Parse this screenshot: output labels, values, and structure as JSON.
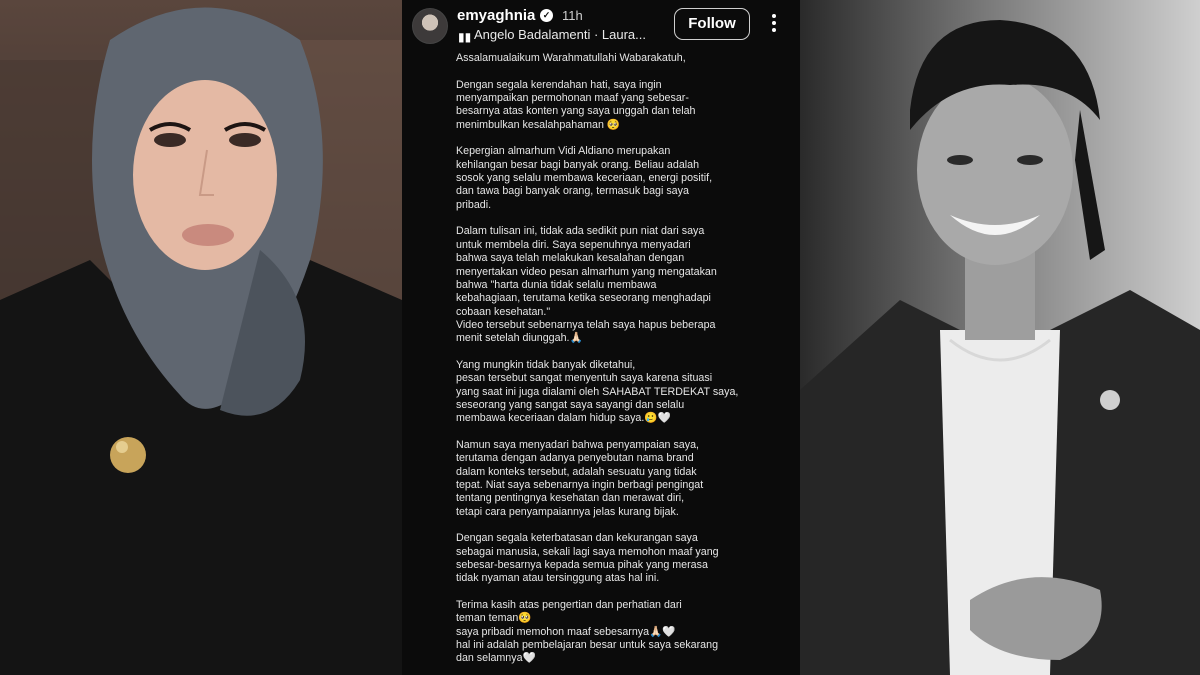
{
  "story": {
    "username": "emyaghnia",
    "time": "11h",
    "music": "Angelo Badalamenti · Laura...",
    "follow_label": "Follow",
    "icons": {
      "verified": "verified-badge-icon",
      "music": "music-note-icon",
      "more": "more-vertical-icon"
    },
    "paragraphs": [
      [
        "Assalamualaikum Warahmatullahi Wabarakatuh,"
      ],
      [
        "Dengan segala kerendahan hati, saya ingin",
        "menyampaikan permohonan maaf yang sebesar-",
        "besarnya atas konten yang saya unggah dan telah",
        "menimbulkan kesalahpahaman 🥺"
      ],
      [
        "Kepergian almarhum Vidi Aldiano merupakan",
        "kehilangan besar bagi banyak orang. Beliau adalah",
        "sosok yang selalu membawa keceriaan, energi positif,",
        "dan tawa bagi banyak orang, termasuk bagi saya",
        "pribadi."
      ],
      [
        "Dalam tulisan ini, tidak ada sedikit pun niat dari saya",
        "untuk membela diri. Saya sepenuhnya menyadari",
        "bahwa saya telah melakukan kesalahan dengan",
        "menyertakan video pesan almarhum yang mengatakan",
        "bahwa \"harta dunia tidak selalu membawa",
        "kebahagiaan, terutama ketika seseorang menghadapi",
        "cobaan kesehatan.\"",
        "Video tersebut sebenarnya telah saya hapus beberapa",
        "menit setelah diunggah.🙏🏻"
      ],
      [
        "Yang mungkin tidak banyak diketahui,",
        "pesan tersebut sangat menyentuh saya karena situasi",
        "yang saat ini juga dialami oleh SAHABAT TERDEKAT saya,",
        "seseorang yang sangat saya sayangi dan selalu",
        "membawa keceriaan dalam hidup saya.🥲🤍"
      ],
      [
        "Namun saya menyadari bahwa penyampaian saya,",
        "terutama dengan adanya penyebutan nama brand",
        "dalam konteks tersebut, adalah sesuatu yang tidak",
        "tepat. Niat saya sebenarnya ingin berbagi pengingat",
        "tentang pentingnya kesehatan dan merawat diri,",
        "tetapi cara penyampaiannya jelas kurang bijak."
      ],
      [
        "Dengan segala keterbatasan dan kekurangan saya",
        "sebagai manusia, sekali lagi saya memohon maaf yang",
        "sebesar-besarnya kepada semua pihak yang merasa",
        "tidak nyaman atau tersinggung atas hal ini."
      ],
      [
        "Terima kasih atas pengertian dan perhatian dari",
        "teman teman🥺",
        "saya pribadi memohon maaf sebesarnya🙏🏻🤍",
        "hal ini adalah pembelajaran besar untuk saya sekarang",
        "dan selamnya🤍"
      ]
    ]
  },
  "photos": {
    "left": {
      "hijab_color": "#5f6670",
      "face_color": "#e4b9a4",
      "lip_color": "#c98a7e",
      "outfit_color": "#141414",
      "brooch_color": "#c8a45a"
    },
    "right": {
      "hair_color": "#161616",
      "face_color": "#a9a9a9",
      "shirt_color": "#ececec",
      "jacket_color": "#262626"
    }
  }
}
